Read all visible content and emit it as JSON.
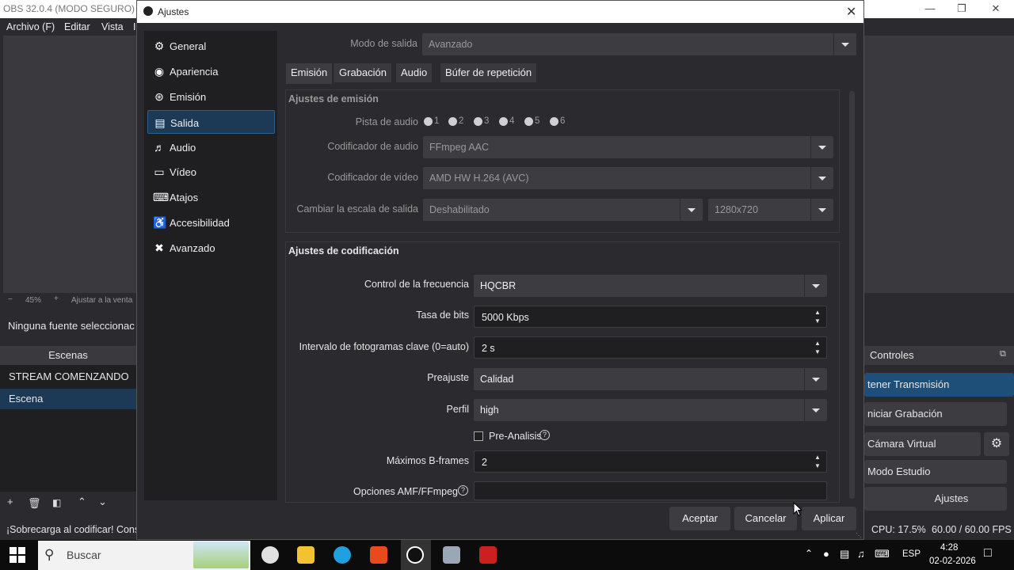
{
  "obs": {
    "title": "OBS 32.0.4 (MODO SEGURO) -",
    "menu": [
      "Archivo (F)",
      "Editar",
      "Vista",
      "I"
    ],
    "zoom": "45%",
    "zoom_fit": "Ajustar a la venta",
    "no_source": "Ninguna fuente seleccionac",
    "scenes_header": "Escenas",
    "scenes": [
      "STREAM COMENZANDO",
      "Escena"
    ],
    "controls_header": "Controles",
    "controls": [
      "tener Transmisión",
      "niciar Grabación",
      "Cámara Virtual",
      "Modo Estudio",
      "Ajustes"
    ],
    "status_warning": "¡Sobrecarga al codificar! Cons",
    "cpu": "CPU: 17.5%",
    "fps": "60.00 / 60.00 FPS"
  },
  "dialog": {
    "title": "Ajustes",
    "nav": [
      {
        "label": "General",
        "icon": "gear-icon"
      },
      {
        "label": "Apariencia",
        "icon": "palette-icon"
      },
      {
        "label": "Emisión",
        "icon": "antenna-icon"
      },
      {
        "label": "Salida",
        "icon": "output-icon"
      },
      {
        "label": "Audio",
        "icon": "speaker-icon"
      },
      {
        "label": "Vídeo",
        "icon": "monitor-icon"
      },
      {
        "label": "Atajos",
        "icon": "keyboard-icon"
      },
      {
        "label": "Accesibilidad",
        "icon": "accessibility-icon"
      },
      {
        "label": "Avanzado",
        "icon": "tools-icon"
      }
    ],
    "output_mode_label": "Modo de salida",
    "output_mode_value": "Avanzado",
    "tabs": [
      "Emisión",
      "Grabación",
      "Audio",
      "Búfer de repetición"
    ],
    "stream_group": {
      "title": "Ajustes de emisión",
      "audio_track_label": "Pista de audio",
      "audio_tracks": [
        "1",
        "2",
        "3",
        "4",
        "5",
        "6"
      ],
      "audio_encoder_label": "Codificador de audio",
      "audio_encoder_value": "FFmpeg AAC",
      "video_encoder_label": "Codificador de vídeo",
      "video_encoder_value": "AMD HW H.264 (AVC)",
      "rescale_label": "Cambiar la escala de salida",
      "rescale_value": "Deshabilitado",
      "rescale_res": "1280x720"
    },
    "encoding_group": {
      "title": "Ajustes de codificación",
      "rate_control_label": "Control de la frecuencia",
      "rate_control_value": "HQCBR",
      "bitrate_label": "Tasa de bits",
      "bitrate_value": "5000 Kbps",
      "keyframe_label": "Intervalo de fotogramas clave (0=auto)",
      "keyframe_value": "2 s",
      "preset_label": "Preajuste",
      "preset_value": "Calidad",
      "profile_label": "Perfil",
      "profile_value": "high",
      "preanalysis_label": "Pre-Analisis",
      "bframes_label": "Máximos B-frames",
      "bframes_value": "2",
      "amf_label": "Opciones AMF/FFmpeg",
      "amf_value": ""
    },
    "buttons": {
      "ok": "Aceptar",
      "cancel": "Cancelar",
      "apply": "Aplicar"
    }
  },
  "taskbar": {
    "search_placeholder": "Buscar",
    "language": "ESP",
    "time": "4:28",
    "date": "02-02-2026"
  }
}
